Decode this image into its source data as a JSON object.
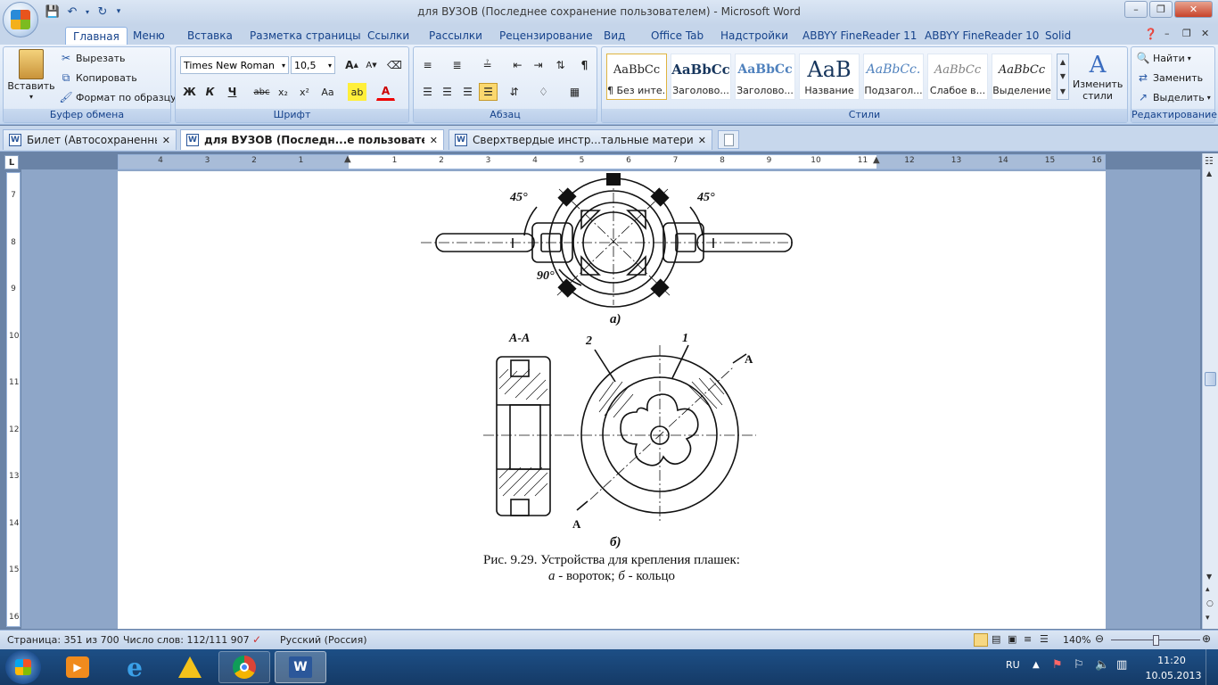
{
  "window": {
    "title": "для ВУЗОВ (Последнее сохранение пользователем) - Microsoft Word"
  },
  "quick_access": {
    "save_icon": "save-icon",
    "undo_icon": "undo-icon",
    "redo_icon": "redo-icon"
  },
  "ribbon_tabs": [
    "Главная",
    "Меню",
    "Вставка",
    "Разметка страницы",
    "Ссылки",
    "Рассылки",
    "Рецензирование",
    "Вид",
    "Office Tab",
    "Надстройки",
    "ABBYY FineReader 11",
    "ABBYY FineReader 10",
    "Solid"
  ],
  "clipboard": {
    "paste": "Вставить",
    "cut": "Вырезать",
    "copy": "Копировать",
    "format_painter": "Формат по образцу",
    "label": "Буфер обмена"
  },
  "font": {
    "name": "Times New Roman",
    "size": "10,5",
    "label": "Шрифт",
    "bold": "Ж",
    "italic": "К",
    "underline": "Ч",
    "strike": "abc",
    "subscript": "x₂",
    "superscript": "x²",
    "case": "Aa",
    "grow": "A",
    "shrink": "A"
  },
  "paragraph": {
    "label": "Абзац"
  },
  "styles": {
    "label": "Стили",
    "tiles": [
      {
        "preview": "AaBbCc",
        "name": "¶ Без инте..."
      },
      {
        "preview": "AaBbCc",
        "name": "Заголово..."
      },
      {
        "preview": "AaBbCc",
        "name": "Заголово..."
      },
      {
        "preview": "AaB",
        "name": "Название"
      },
      {
        "preview": "AaBbCc.",
        "name": "Подзагол..."
      },
      {
        "preview": "AaBbCc",
        "name": "Слабое в..."
      },
      {
        "preview": "AaBbCc",
        "name": "Выделение"
      }
    ],
    "change_styles": "Изменить стили"
  },
  "editing": {
    "find": "Найти",
    "replace": "Заменить",
    "select": "Выделить",
    "label": "Редактирование"
  },
  "doc_tabs": [
    {
      "title": "Билет (Автосохраненный)"
    },
    {
      "title": "для ВУЗОВ (Последн...е пользователем) *"
    },
    {
      "title": "Сверхтвердые инстр...тальные материалы *"
    }
  ],
  "ruler": {
    "labels": [
      "4",
      "3",
      "2",
      "1",
      "",
      "1",
      "2",
      "3",
      "4",
      "5",
      "6",
      "7",
      "8",
      "9",
      "10",
      "11",
      "12",
      "13",
      "14",
      "15",
      "16"
    ],
    "vertical": [
      "7",
      "8",
      "9",
      "10",
      "11",
      "12",
      "13",
      "14",
      "15",
      "16"
    ]
  },
  "figure": {
    "angle_left": "45°",
    "angle_right": "45°",
    "angle_bottom": "90°",
    "label_a": "а)",
    "section": "А-А",
    "callout_2": "2",
    "callout_1": "1",
    "section_mark_top": "А",
    "section_mark_bottom": "А",
    "label_b": "б)",
    "caption_line1": "Рис. 9.29. Устройства для крепления плашек:",
    "caption_a": "а",
    "caption_a_text": " - вороток; ",
    "caption_b": "б",
    "caption_b_text": " - кольцо"
  },
  "status": {
    "page": "Страница: 351 из 700",
    "words": "Число слов: 112/111 907",
    "language": "Русский (Россия)",
    "zoom": "140%"
  },
  "taskbar": {
    "lang": "RU",
    "time": "11:20",
    "date": "10.05.2013"
  }
}
